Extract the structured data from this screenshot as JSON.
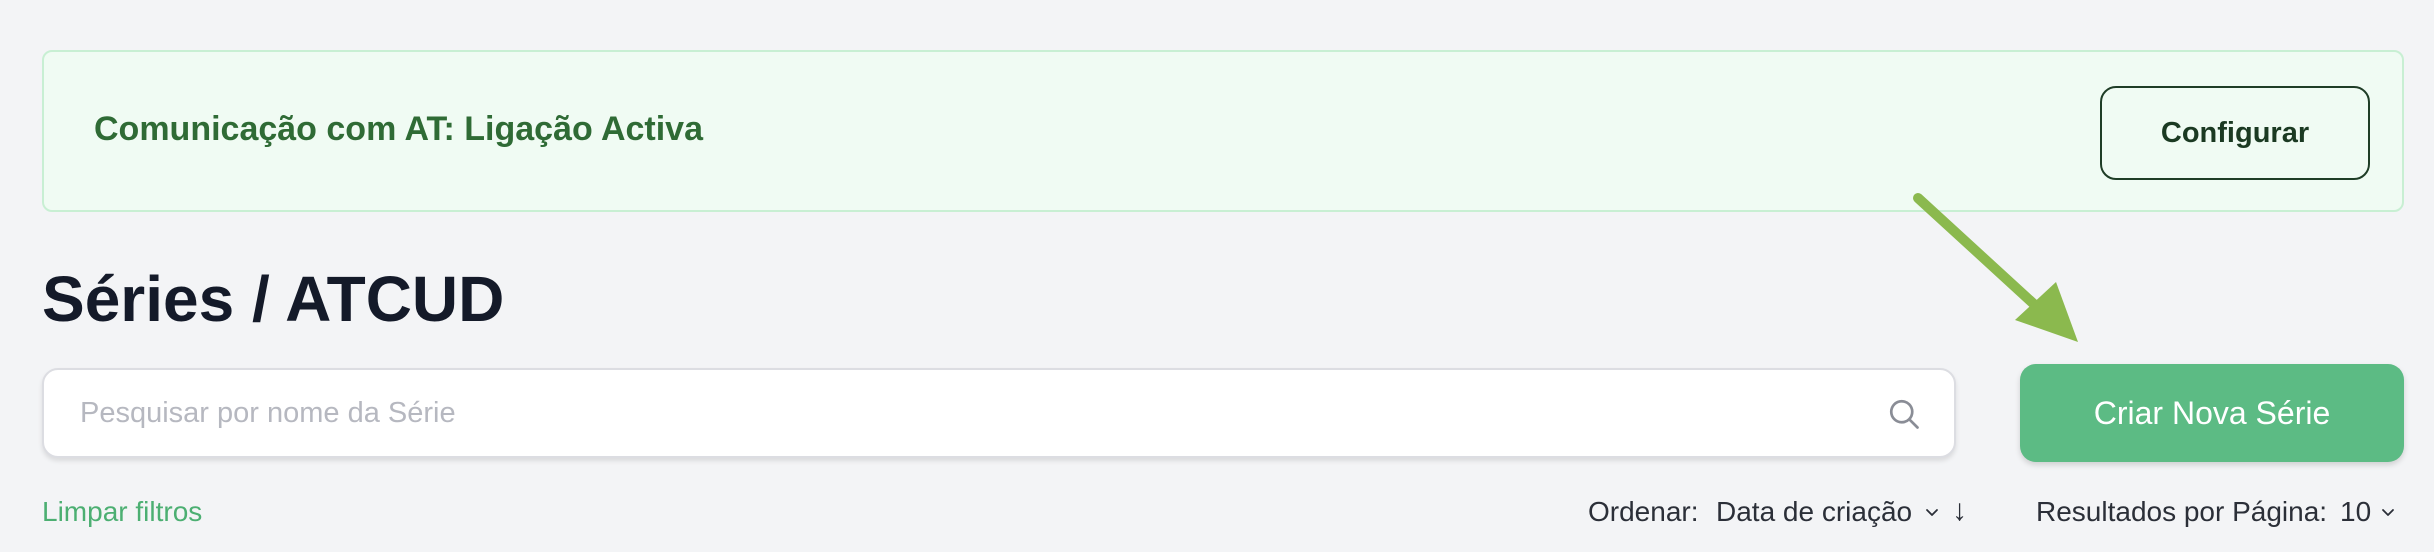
{
  "banner": {
    "status_text": "Comunicação com AT: Ligação Activa",
    "configure_label": "Configurar"
  },
  "page": {
    "title": "Séries / ATCUD"
  },
  "search": {
    "placeholder": "Pesquisar por nome da Série",
    "value": ""
  },
  "actions": {
    "create_label": "Criar Nova Série"
  },
  "filters": {
    "clear_label": "Limpar filtros",
    "sort_label": "Ordenar:",
    "sort_value": "Data de criação",
    "sort_direction": "↓",
    "per_page_label": "Resultados por Página:",
    "per_page_value": "10"
  },
  "colors": {
    "accent": "#5cbb84",
    "banner_bg": "#f0fbf3",
    "banner_text": "#2f6b35",
    "annotation_arrow": "#8bb94e"
  },
  "icons": {
    "search": "search-icon",
    "sort_chevron": "chevron-down-icon",
    "per_page_chevron": "chevron-down-icon",
    "annotation": "arrow-annotation-icon"
  }
}
